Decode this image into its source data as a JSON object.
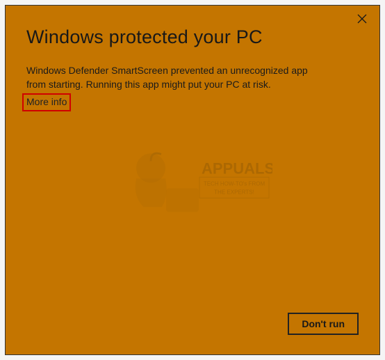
{
  "title": "Windows protected your PC",
  "body_text": "Windows Defender SmartScreen prevented an unrecognized app from starting. Running this app might put your PC at risk.",
  "more_info_label": "More info",
  "buttons": {
    "dont_run": "Don't run"
  },
  "watermark": {
    "brand": "APPUALS",
    "tagline1": "TECH HOW-TO's FROM",
    "tagline2": "THE EXPERTS!"
  }
}
